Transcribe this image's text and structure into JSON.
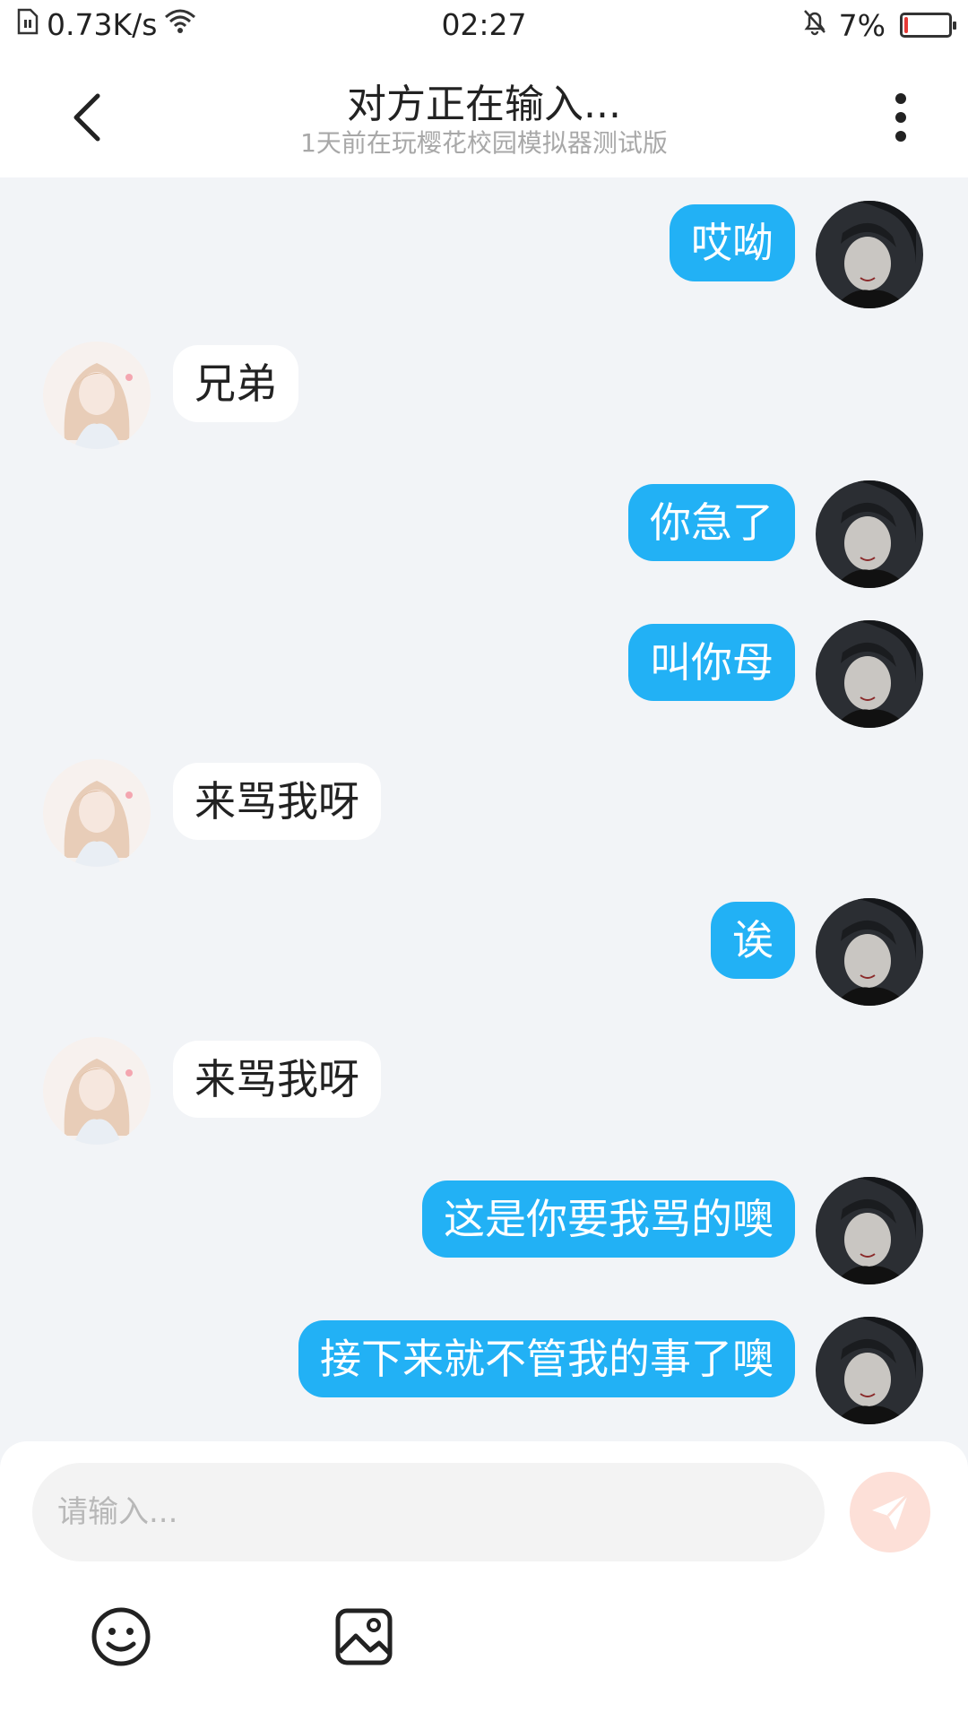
{
  "status_bar": {
    "speed": "0.73K/s",
    "time": "02:27",
    "battery": "7%",
    "battery_level": 0.07,
    "battery_color": "#e53935"
  },
  "header": {
    "title": "对方正在输入...",
    "subtitle": "1天前在玩樱花校园模拟器测试版"
  },
  "colors": {
    "accent": "#22b1f5",
    "background": "#f2f4f7",
    "send_button": "#fde0d8"
  },
  "messages": [
    {
      "side": "right",
      "text": "哎呦"
    },
    {
      "side": "left",
      "text": "兄弟"
    },
    {
      "side": "right",
      "text": "你急了"
    },
    {
      "side": "right",
      "text": "叫你母"
    },
    {
      "side": "left",
      "text": "来骂我呀"
    },
    {
      "side": "right",
      "text": "诶"
    },
    {
      "side": "left",
      "text": "来骂我呀"
    },
    {
      "side": "right",
      "text": "这是你要我骂的噢"
    },
    {
      "side": "right",
      "text": "接下来就不管我的事了噢"
    }
  ],
  "composer": {
    "placeholder": "请输入..."
  },
  "icons": {
    "back": "chevron-left-icon",
    "more": "more-vertical-icon",
    "send": "send-icon",
    "emoji": "emoji-icon",
    "image": "image-icon"
  }
}
